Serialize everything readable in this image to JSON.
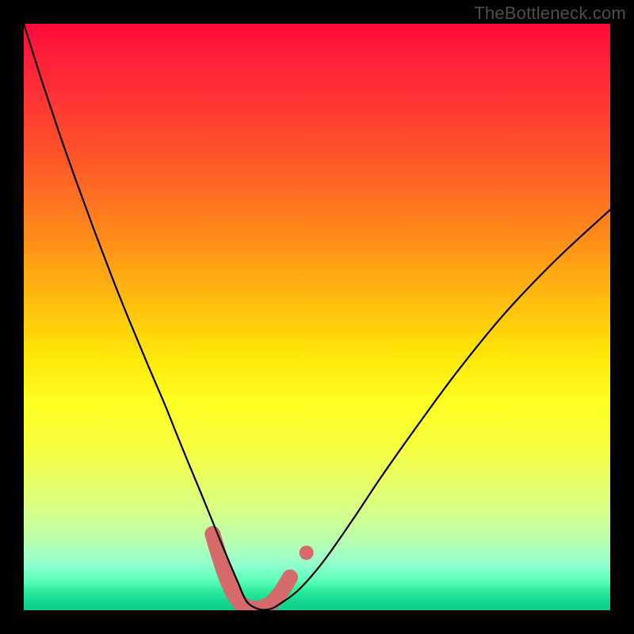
{
  "watermark": "TheBottleneck.com",
  "colors": {
    "background": "#000000",
    "curve": "#000000",
    "marker_fill": "#d46a6a",
    "marker_stroke": "#c85a5a"
  },
  "chart_data": {
    "type": "line",
    "title": "",
    "xlabel": "",
    "ylabel": "",
    "xlim": [
      0,
      100
    ],
    "ylim": [
      0,
      100
    ],
    "grid": false,
    "legend": false,
    "note": "Values are read from pixel positions; y = 0 is the bottom green band, y = 100 is the top, x spans the gradient panel width. No axis ticks or numeric labels are rendered in the source image.",
    "series": [
      {
        "name": "bottleneck-curve",
        "x": [
          0,
          3,
          6,
          9,
          12,
          15,
          18,
          21,
          24,
          26,
          28,
          30,
          32,
          33.5,
          35,
          36.5,
          38,
          40,
          42,
          44,
          47,
          51,
          56,
          61,
          67,
          74,
          82,
          91,
          100
        ],
        "y": [
          100,
          90.5,
          81.5,
          73,
          64.8,
          56.9,
          49.4,
          42.2,
          35.2,
          30.2,
          25.3,
          20.5,
          15.6,
          11.9,
          8.3,
          4.8,
          1.5,
          0.2,
          0.2,
          1.3,
          3.6,
          8.2,
          15.3,
          22.8,
          31.3,
          40.8,
          50.6,
          60.0,
          68.3
        ]
      }
    ],
    "markers": {
      "name": "highlight-band",
      "style": "thick-rounded",
      "color": "#d46a6a",
      "x": [
        32.2,
        33.4,
        34.6,
        35.8,
        37.0,
        38.2,
        39.4,
        40.6,
        41.8,
        43.0,
        44.2,
        45.4
      ],
      "y": [
        13.0,
        9.0,
        5.5,
        2.8,
        1.2,
        0.4,
        0.3,
        0.4,
        0.9,
        2.0,
        3.6,
        5.6
      ],
      "extra_point": {
        "x": 48.2,
        "y": 9.8
      }
    }
  }
}
